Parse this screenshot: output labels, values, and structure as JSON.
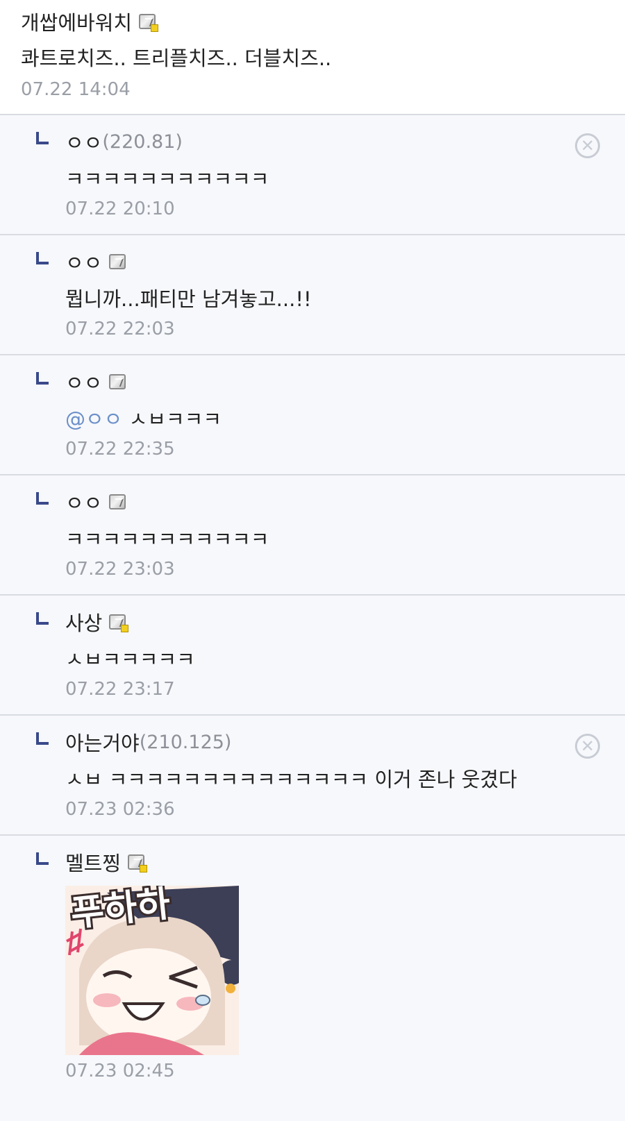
{
  "post_comment": {
    "author": "개쌉에바워치",
    "text": "콰트로치즈.. 트리플치즈.. 더블치즈..",
    "time": "07.22 14:04"
  },
  "replies": [
    {
      "author": "ㅇㅇ",
      "ip": "(220.81)",
      "text": "ㅋㅋㅋㅋㅋㅋㅋㅋㅋㅋㅋ",
      "time": "07.22 20:10",
      "deletable": true
    },
    {
      "author": "ㅇㅇ",
      "text": "뭡니까...패티만 남겨놓고...!!",
      "time": "07.22 22:03",
      "badge": "gray"
    },
    {
      "author": "ㅇㅇ",
      "mention": "@ㅇㅇ",
      "text": "ㅅㅂㅋㅋㅋ",
      "time": "07.22 22:35",
      "badge": "gray"
    },
    {
      "author": "ㅇㅇ",
      "text": "ㅋㅋㅋㅋㅋㅋㅋㅋㅋㅋㅋ",
      "time": "07.22 23:03",
      "badge": "gray"
    },
    {
      "author": "사상",
      "text": "ㅅㅂㅋㅋㅋㅋㅋ",
      "time": "07.22 23:17",
      "badge": "gold"
    },
    {
      "author": "아는거야",
      "ip": "(210.125)",
      "text": "ㅅㅂ ㅋㅋㅋㅋㅋㅋㅋㅋㅋㅋㅋㅋㅋㅋ 이거 존나 웃겼다",
      "time": "07.23 02:36",
      "deletable": true
    },
    {
      "author": "멜트찡",
      "sticker_text": "푸하하",
      "time": "07.23 02:45",
      "badge": "gold"
    }
  ],
  "icons": {
    "reply": "reply-arrow-icon",
    "delete": "close-circle-icon",
    "badge": "member-badge-icon"
  },
  "colors": {
    "reply_bg": "#f7f8fb",
    "divider": "#d8dbe2",
    "timestamp": "#9a9ea6",
    "mention": "#6b8fc9",
    "reply_arrow": "#3a4a8a"
  }
}
